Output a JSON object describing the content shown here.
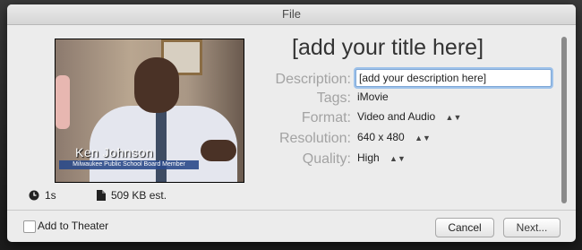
{
  "window": {
    "title": "File"
  },
  "preview": {
    "caption_name": "Ken Johnson",
    "caption_role": "Milwaukee Public School Board Member",
    "duration": "1s",
    "size": "509 KB est."
  },
  "form": {
    "title": "[add your title here]",
    "description": {
      "label": "Description:",
      "value": "[add your description here]"
    },
    "tags": {
      "label": "Tags:",
      "value": "iMovie"
    },
    "format": {
      "label": "Format:",
      "value": "Video and Audio"
    },
    "resolution": {
      "label": "Resolution:",
      "value": "640 x 480"
    },
    "quality": {
      "label": "Quality:",
      "value": "High"
    }
  },
  "footer": {
    "add_to_theater": "Add to Theater",
    "cancel": "Cancel",
    "next": "Next..."
  },
  "icons": {
    "duration": "clock-icon",
    "size": "document-icon",
    "stepper": "up-down-stepper-icon"
  }
}
